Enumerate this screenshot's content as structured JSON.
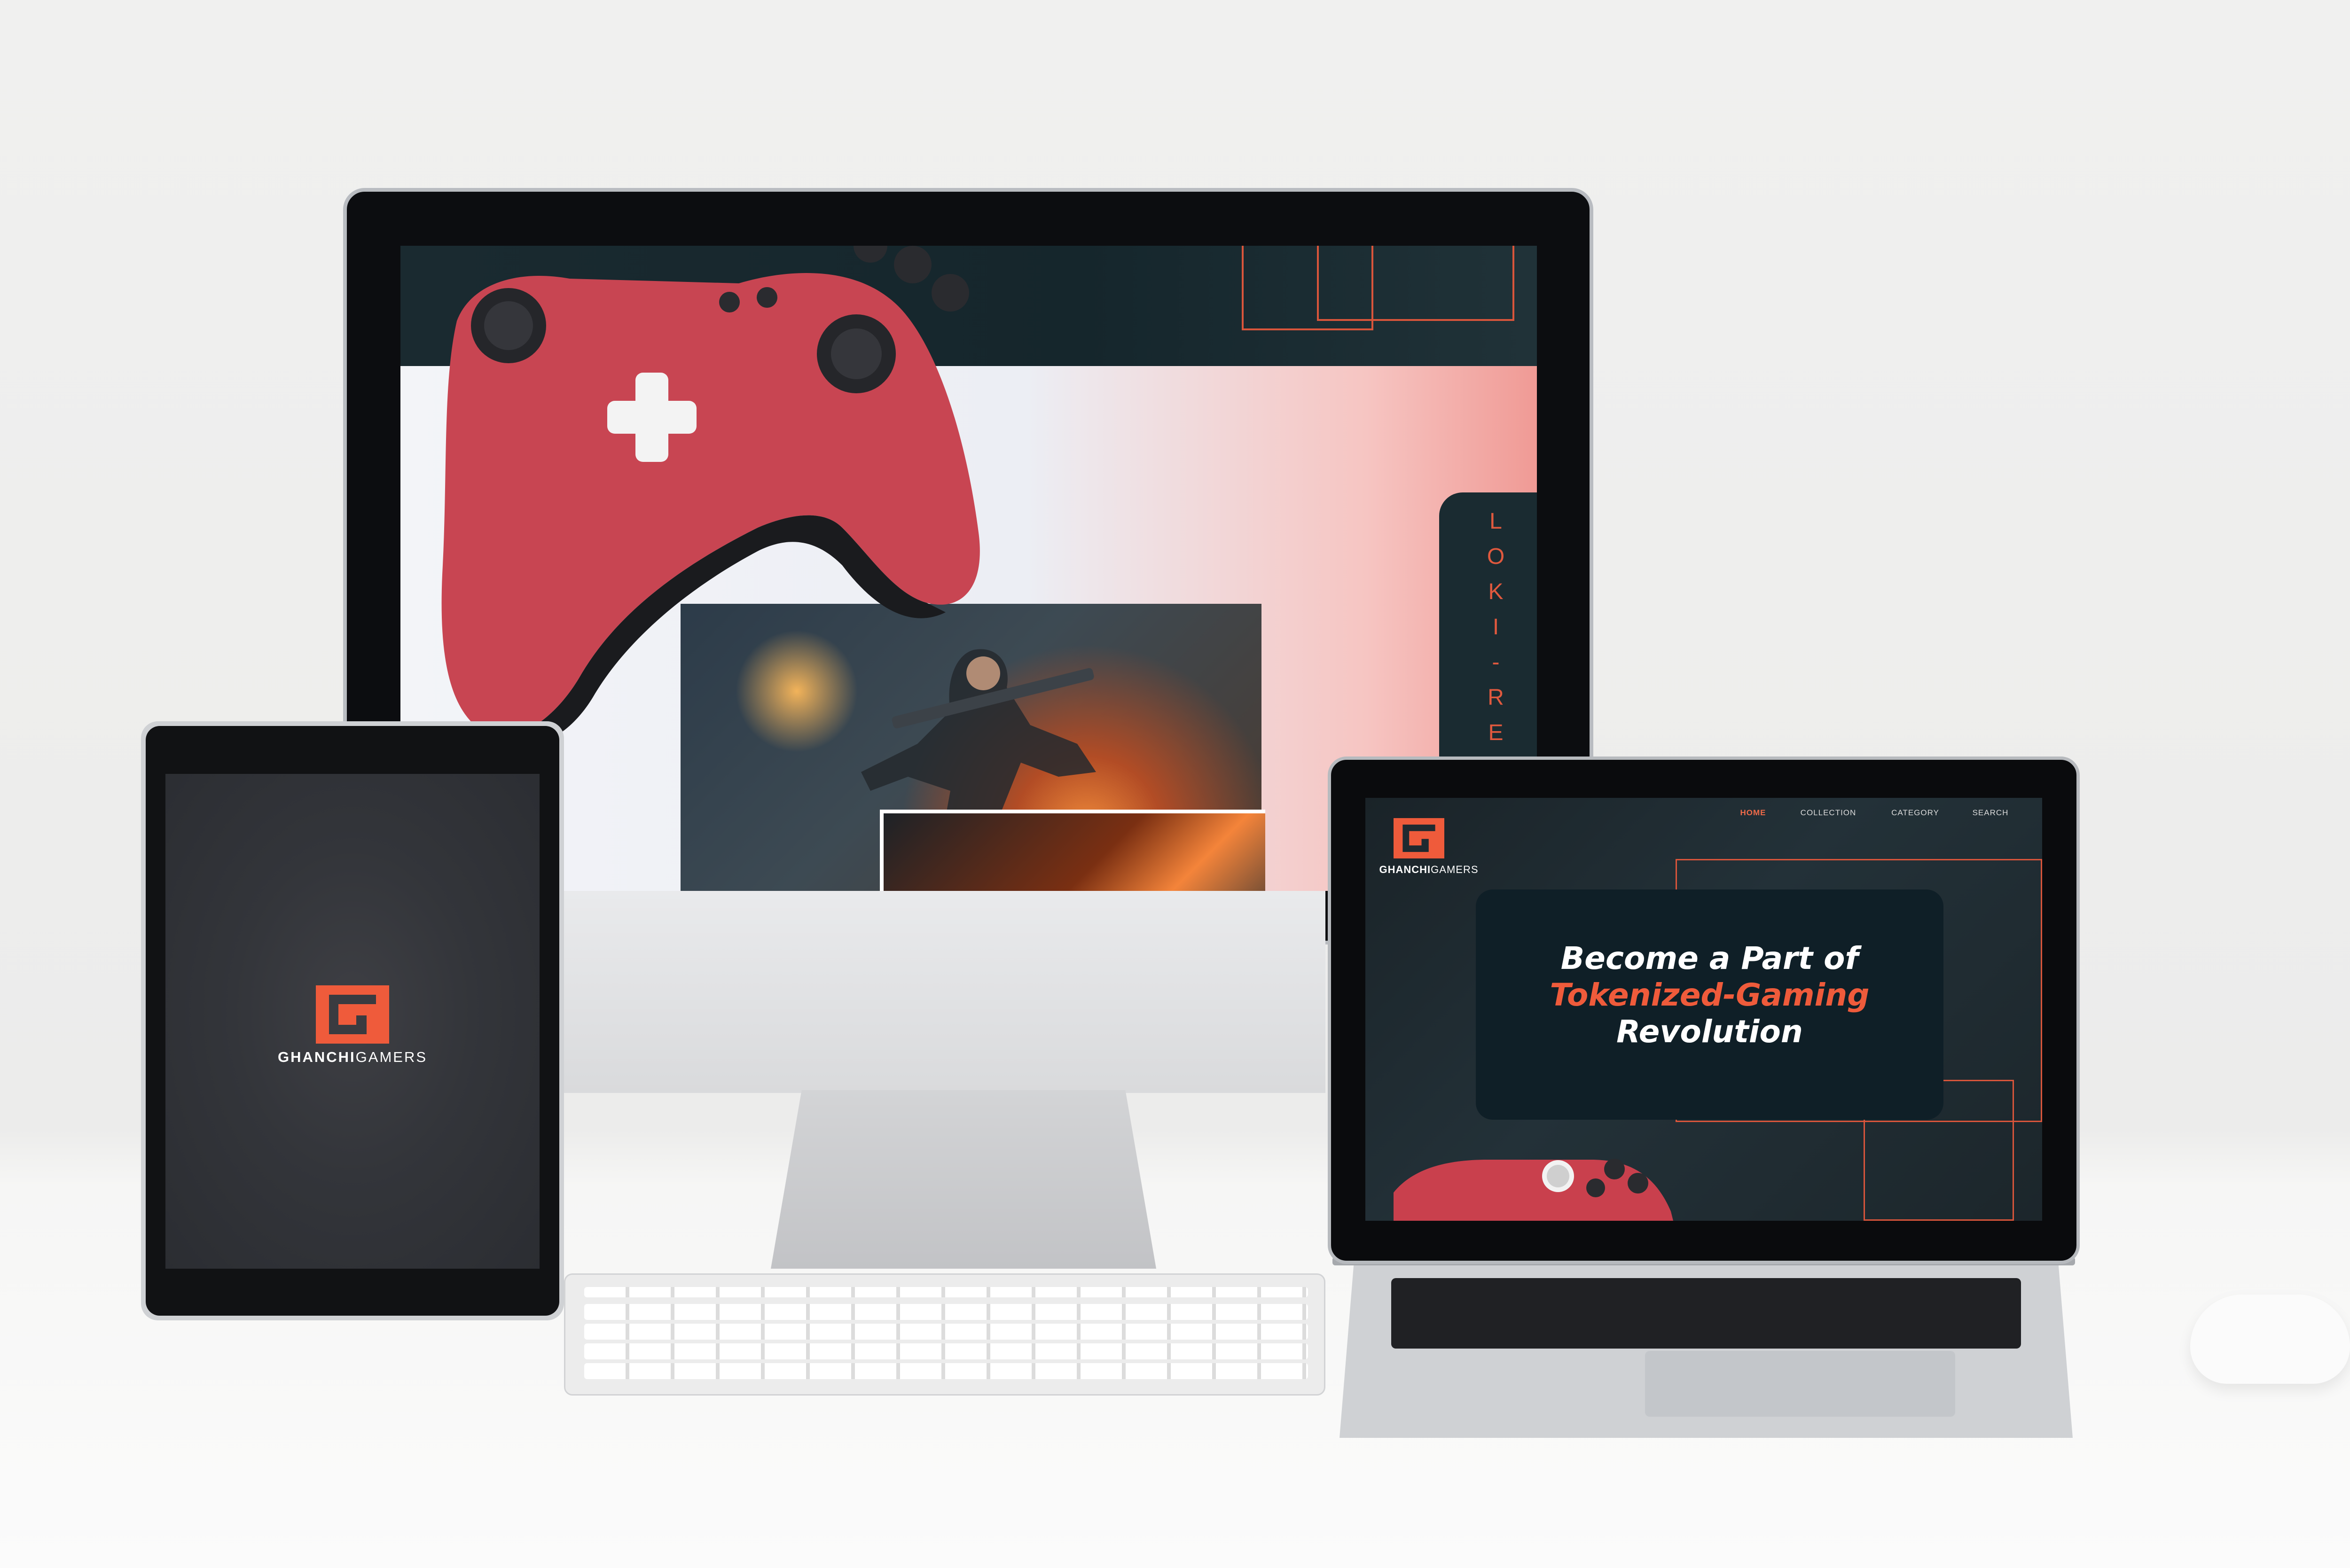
{
  "brand": {
    "name_bold": "GHANCHI",
    "name_light": "GAMERS",
    "accent_color": "#ef5b3b",
    "dark_color": "#0f1f27"
  },
  "monitor": {
    "side_label": "LOKI-REVO"
  },
  "tablet": {
    "brand_bold": "GHANCHI",
    "brand_light": "GAMERS"
  },
  "laptop": {
    "nav": {
      "home": "HOME",
      "collection": "COLLECTION",
      "category": "CATEGORY",
      "search": "SEARCH"
    },
    "hero": {
      "line1": "Become a Part of",
      "line2": "Tokenized-Gaming",
      "line3": "Revolution"
    }
  },
  "icons": [
    "ghanchigamers-logo-icon",
    "xbox-controller-icon",
    "xbox-logo-icon"
  ]
}
